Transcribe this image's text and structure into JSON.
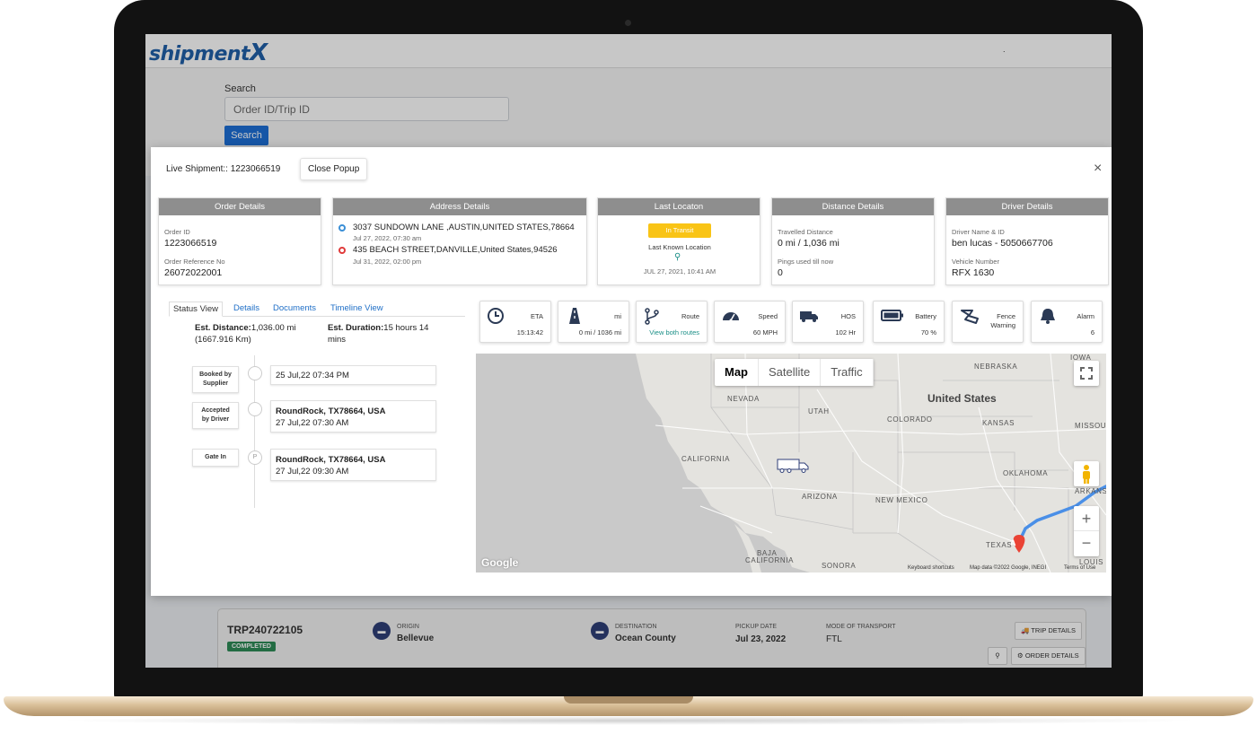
{
  "app": {
    "logo_main": "shipment",
    "logo_x": "X",
    "header_dot": "."
  },
  "search": {
    "label": "Search",
    "placeholder": "Order ID/Trip ID",
    "button_label": "Search"
  },
  "modal": {
    "title": "Live Shipment:: 1223066519",
    "close_popup_label": "Close Popup",
    "close_icon": "×"
  },
  "order_details": {
    "header": "Order Details",
    "order_id_label": "Order ID",
    "order_id": "1223066519",
    "ref_label": "Order Reference No",
    "ref": "26072022001"
  },
  "address_details": {
    "header": "Address Details",
    "pickup": {
      "address": "3037 SUNDOWN LANE ,AUSTIN,UNITED STATES,78664",
      "time": "Jul 27, 2022, 07:30 am",
      "color": "#3b8fd6"
    },
    "drop": {
      "address": "435 BEACH STREET,DANVILLE,United States,94526",
      "time": "Jul 31, 2022, 02:00 pm",
      "color": "#e03b3b"
    }
  },
  "last_location": {
    "header": "Last Locaton",
    "status": "In Transit",
    "label": "Last Known Location",
    "time": "JUL 27, 2021, 10:41 AM"
  },
  "distance_details": {
    "header": "Distance Details",
    "travelled_label": "Travelled Distance",
    "travelled": "0 mi / 1,036 mi",
    "pings_label": "Pings used till now",
    "pings": "0"
  },
  "driver_details": {
    "header": "Driver Details",
    "driver_label": "Driver Name & ID",
    "driver": "ben lucas - 5050667706",
    "vehicle_label": "Vehicle Number",
    "vehicle": "RFX 1630"
  },
  "tabs": [
    "Status View",
    "Details",
    "Documents",
    "Timeline View"
  ],
  "status_view": {
    "distance_label": "Est. Distance:",
    "distance_value": "1,036.00 mi",
    "distance_km": "(1667.916 Km)",
    "duration_label": "Est. Duration:",
    "duration_value": "15 hours 14",
    "duration_unit": "mins",
    "timeline": [
      {
        "tag_line1": "Booked by",
        "tag_line2": "Supplier",
        "circle": "",
        "place": "",
        "time": "25 Jul,22 07:34 PM"
      },
      {
        "tag_line1": "Accepted",
        "tag_line2": "by Driver",
        "circle": "",
        "place": "RoundRock, TX78664, USA",
        "time": "27 Jul,22 07:30 AM"
      },
      {
        "tag_line1": "Gate In",
        "tag_line2": "",
        "circle": "P",
        "place": "RoundRock, TX78664, USA",
        "time": "27 Jul,22 09:30 AM"
      }
    ]
  },
  "metrics": [
    {
      "label": "ETA",
      "value": "15:13:42",
      "icon": "clock-icon"
    },
    {
      "label": "mi",
      "value": "0 mi / 1036 mi",
      "icon": "road-icon"
    },
    {
      "label": "Route",
      "value": "View both routes",
      "icon": "route-icon"
    },
    {
      "label": "Speed",
      "value": "60 MPH",
      "icon": "speedometer-icon"
    },
    {
      "label": "HOS",
      "value": "102 Hr",
      "icon": "truck-icon"
    },
    {
      "label": "Battery",
      "value": "70 %",
      "icon": "battery-icon"
    },
    {
      "label": "Fence Warning",
      "value": "",
      "icon": "fence-icon"
    },
    {
      "label": "Alarm",
      "value": "6",
      "icon": "bell-icon"
    }
  ],
  "map": {
    "type_options": [
      "Map",
      "Satellite",
      "Traffic"
    ],
    "selected_type": "Map",
    "labels": {
      "nebraska": "NEBRASKA",
      "iowa": "IOWA",
      "nevada": "NEVADA",
      "us": "United States",
      "utah": "UTAH",
      "colorado": "COLORADO",
      "kansas": "KANSAS",
      "missouri": "MISSOU",
      "california": "CALIFORNIA",
      "oklahoma": "OKLAHOMA",
      "arkansas": "ARKANS",
      "arizona": "ARIZONA",
      "new_mexico": "NEW MEXICO",
      "texas": "TEXAS",
      "baja1": "BAJA",
      "baja2": "CALIFORNIA",
      "sonora": "SONORA",
      "louisiana": "LOUIS"
    },
    "marker": "A",
    "google": "Google",
    "footer_shortcuts": "Keyboard shortcuts",
    "footer_data": "Map data ©2022 Google, INEGI",
    "footer_terms": "Terms of Use",
    "zoom_in": "+",
    "zoom_out": "−"
  },
  "trip": {
    "id": "TRP240722105",
    "status": "COMPLETED",
    "origin_label": "ORIGIN",
    "origin": "Bellevue",
    "destination_label": "DESTINATION",
    "destination": "Ocean County",
    "pickup_label": "PICKUP DATE",
    "pickup": "Jul 23, 2022",
    "mode_label": "MODE OF TRANSPORT",
    "mode": "FTL",
    "trip_details_label": "TRIP DETAILS",
    "order_details_label": "ORDER DETAILS"
  }
}
